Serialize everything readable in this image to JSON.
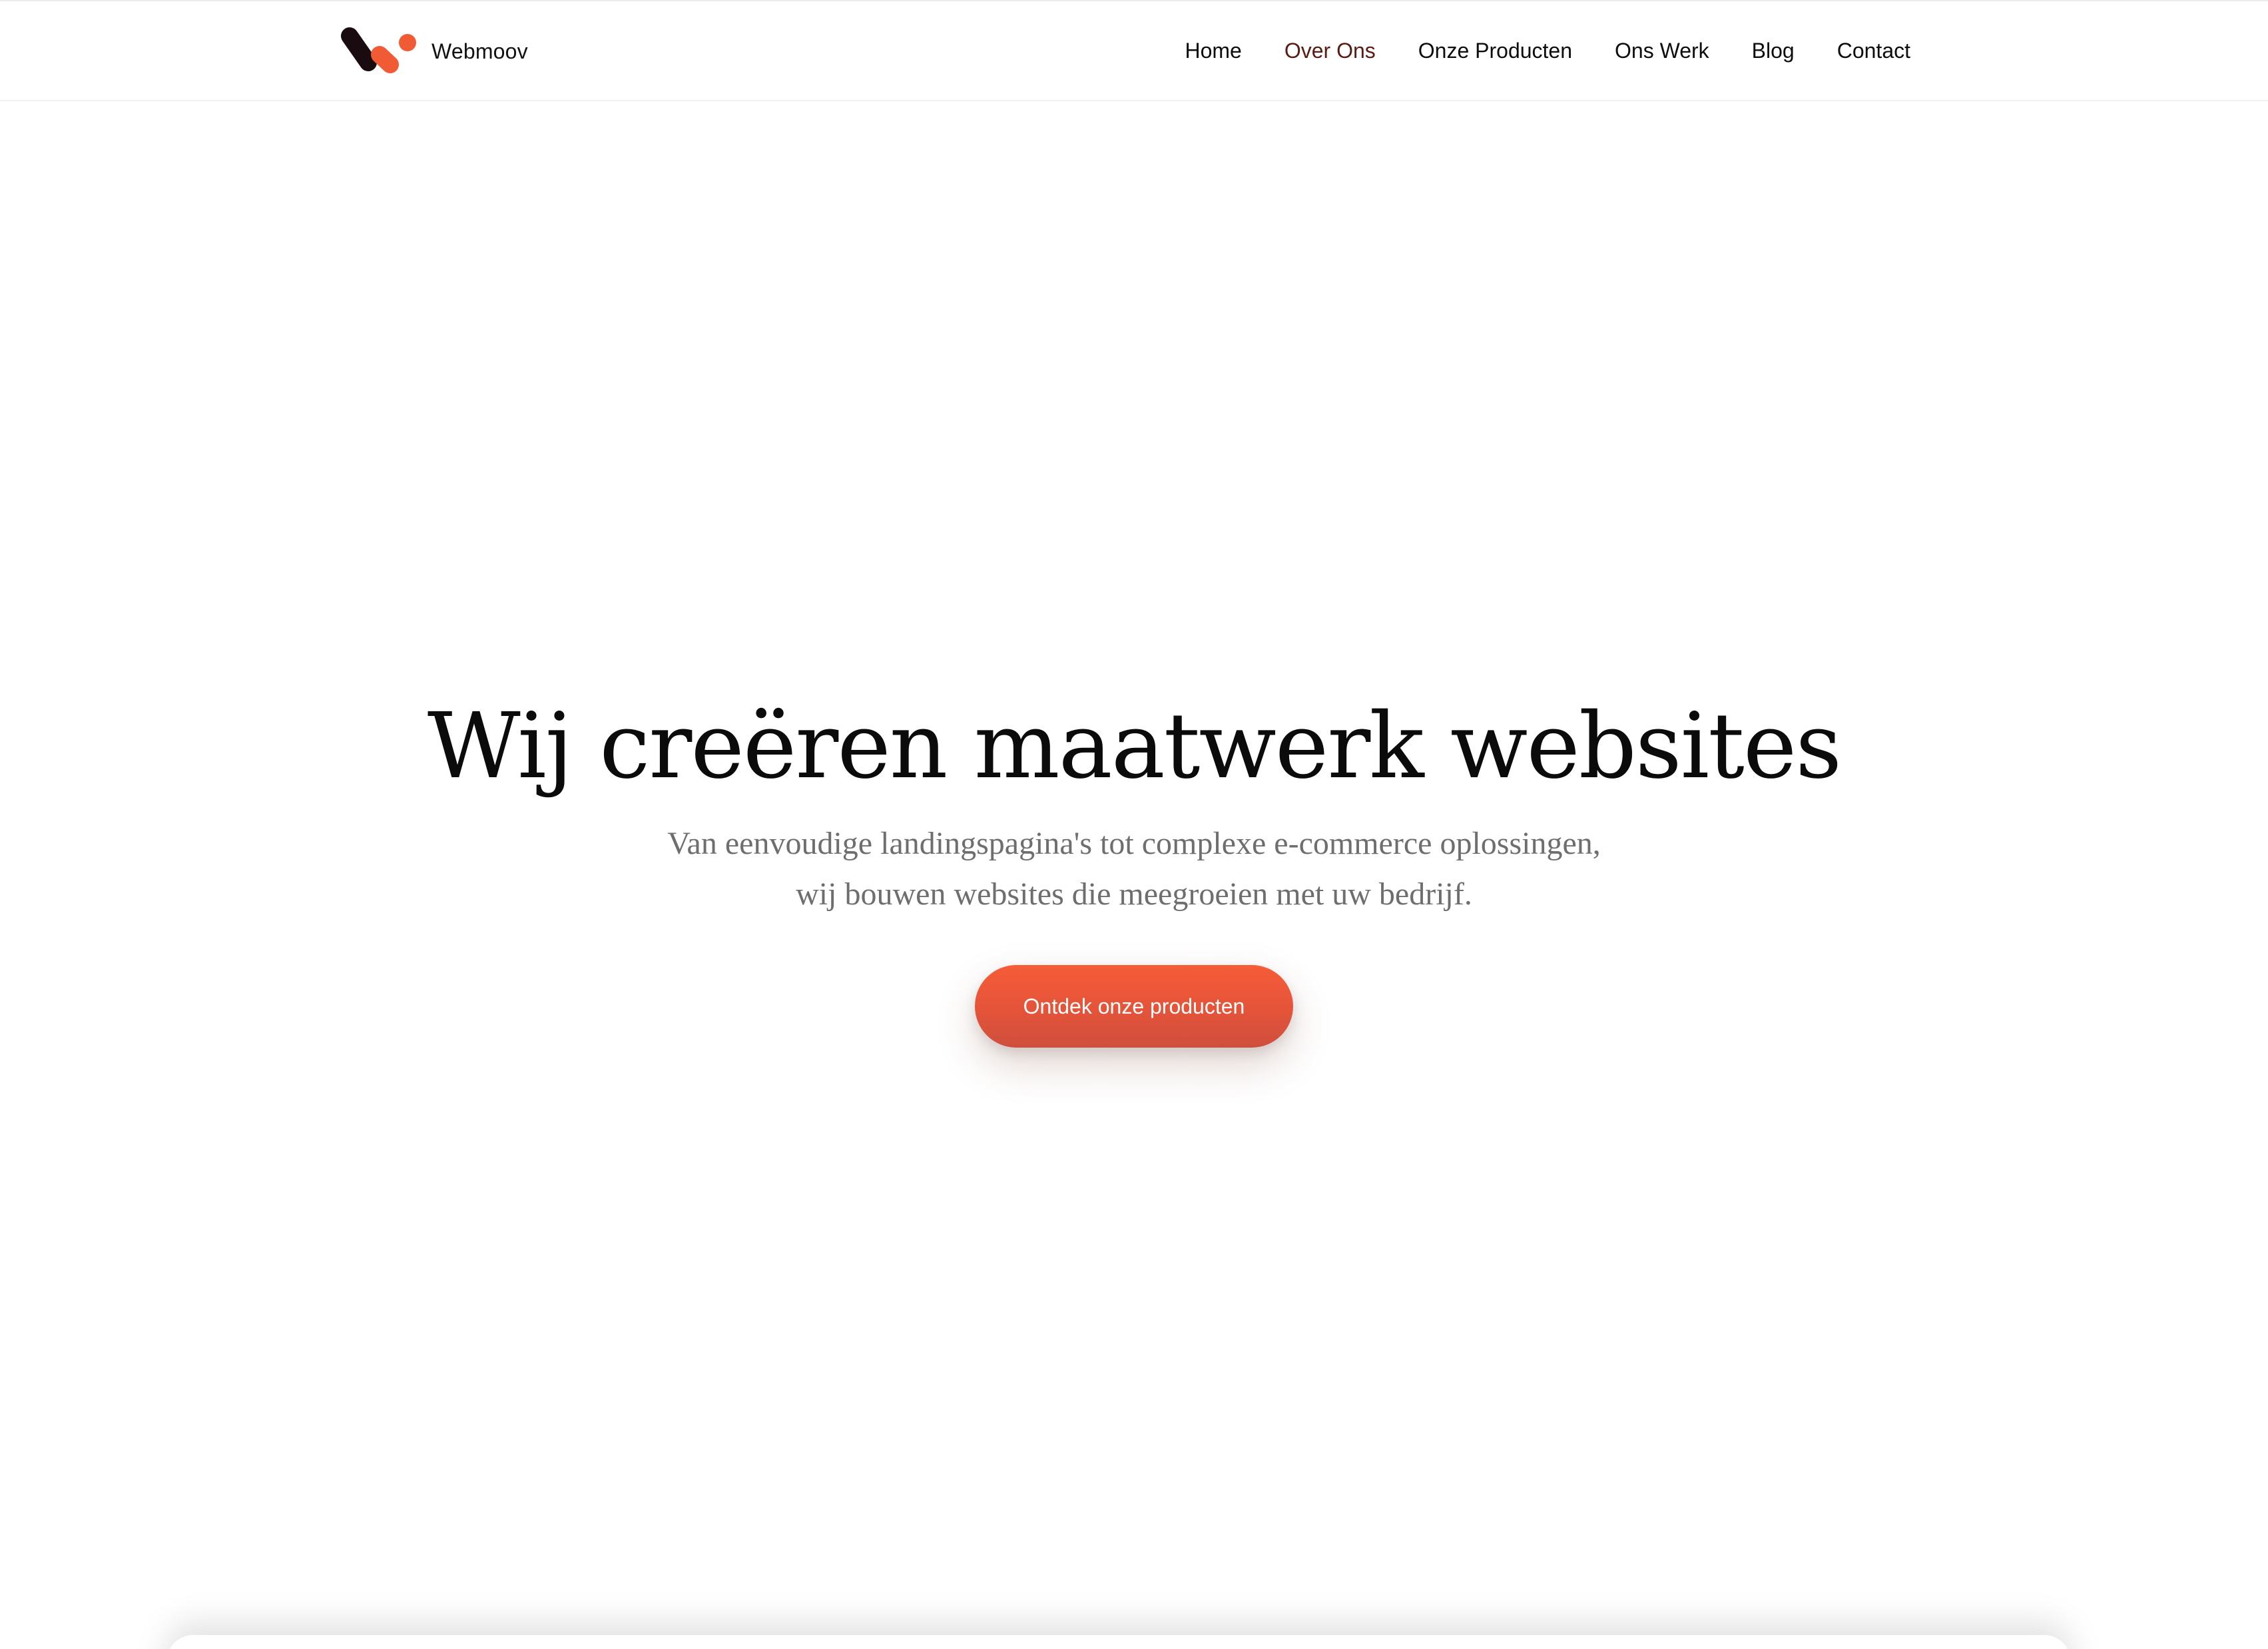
{
  "brand": {
    "name": "Webmoov",
    "logo_icon": "webmoov-logo-icon",
    "colors": {
      "dark": "#1a0b10",
      "accent": "#f05a35"
    }
  },
  "nav": {
    "items": [
      {
        "label": "Home",
        "active": false
      },
      {
        "label": "Over Ons",
        "active": true
      },
      {
        "label": "Onze Producten",
        "active": false
      },
      {
        "label": "Ons Werk",
        "active": false
      },
      {
        "label": "Blog",
        "active": false
      },
      {
        "label": "Contact",
        "active": false
      }
    ]
  },
  "hero": {
    "title": "Wij creëren maatwerk websites",
    "subtitle_line1": "Van eenvoudige landingspagina's tot complexe e-commerce oplossingen,",
    "subtitle_line2": "wij bouwen websites die meegroeien met uw bedrijf.",
    "cta_label": "Ontdek onze producten",
    "cta_color": "#f05a35"
  }
}
